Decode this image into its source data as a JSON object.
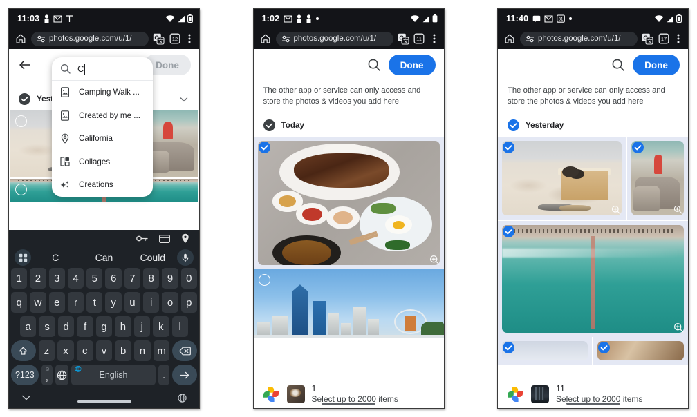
{
  "phones": [
    {
      "id": "phone-1",
      "status": {
        "time": "11:03",
        "left_icons": [
          "person-icon",
          "gmail-icon",
          "signal-t-icon"
        ],
        "right_icons": [
          "wifi-icon",
          "cellular-icon",
          "battery-icon"
        ]
      },
      "browser": {
        "url": "photos.google.com/u/1/",
        "home_icon": "home-icon",
        "lock_icon": "tune-icon",
        "translate_icon": "translate-icon",
        "tabs_icon": "tabs-icon",
        "menu_icon": "kebab-menu-icon",
        "tab_count": "12"
      },
      "app_header": {
        "back_icon": "back-arrow-icon",
        "done_label": "Done",
        "done_disabled": true
      },
      "section": {
        "label": "Yesterday",
        "checked": true
      },
      "search_overlay": {
        "query": "C",
        "search_icon": "search-icon",
        "suggestions": [
          {
            "icon": "photo-album-icon",
            "label": "Camping Walk ..."
          },
          {
            "icon": "photo-album-icon",
            "label": "Created by me ..."
          },
          {
            "icon": "location-pin-icon",
            "label": "California"
          },
          {
            "icon": "collage-icon",
            "label": "Collages"
          },
          {
            "icon": "sparkle-icon",
            "label": "Creations"
          }
        ]
      },
      "keyboard": {
        "toolbar_icons": [
          "key-icon",
          "card-icon",
          "location-pin-icon"
        ],
        "apps_icon": "keyboard-apps-icon",
        "mic_icon": "microphone-icon",
        "suggestions": [
          "C",
          "Can",
          "Could"
        ],
        "rows": [
          [
            "1",
            "2",
            "3",
            "4",
            "5",
            "6",
            "7",
            "8",
            "9",
            "0"
          ],
          [
            "q",
            "w",
            "e",
            "r",
            "t",
            "y",
            "u",
            "i",
            "o",
            "p"
          ],
          [
            "a",
            "s",
            "d",
            "f",
            "g",
            "h",
            "j",
            "k",
            "l"
          ],
          [
            "z",
            "x",
            "c",
            "v",
            "b",
            "n",
            "m"
          ]
        ],
        "shift_icon": "shift-icon",
        "backspace_icon": "backspace-icon",
        "symbols_label": "?123",
        "comma_label": ",",
        "comma_sup": "☺",
        "globe_icon": "globe-icon",
        "space_label": "English",
        "space_sup": "🌐",
        "period_label": ".",
        "enter_icon": "enter-arrow-icon",
        "nav_down_icon": "chevron-down-icon",
        "nav_globe_icon": "globe-icon"
      }
    },
    {
      "id": "phone-2",
      "status": {
        "time": "1:02",
        "left_icons": [
          "gmail-icon",
          "person-icon",
          "person-icon",
          "dot-icon"
        ],
        "right_icons": [
          "wifi-icon",
          "cellular-icon",
          "battery-icon"
        ]
      },
      "browser": {
        "url": "photos.google.com/u/1/",
        "home_icon": "home-icon",
        "lock_icon": "tune-icon",
        "translate_icon": "translate-icon",
        "tabs_icon": "tabs-icon",
        "menu_icon": "kebab-menu-icon",
        "tab_count": "11"
      },
      "app_header": {
        "search_icon": "search-icon",
        "done_label": "Done",
        "done_disabled": false
      },
      "notice": "The other app or service can only access and store the photos & videos you add here",
      "section": {
        "label": "Today",
        "checked": true,
        "checked_color": "#3c4043"
      },
      "bottom": {
        "count": "1",
        "hint": "Select up to 2000 items",
        "logo": "google-photos-logo",
        "thumb": "food-photo-thumb"
      }
    },
    {
      "id": "phone-3",
      "status": {
        "time": "11:40",
        "left_icons": [
          "message-icon",
          "gmail-icon",
          "calendar-icon",
          "dot-icon"
        ],
        "right_icons": [
          "wifi-icon",
          "cellular-icon",
          "battery-icon"
        ]
      },
      "browser": {
        "url": "photos.google.com/u/1/",
        "home_icon": "home-icon",
        "lock_icon": "tune-icon",
        "translate_icon": "translate-icon",
        "tabs_icon": "tabs-icon",
        "menu_icon": "kebab-menu-icon",
        "tab_count": "17"
      },
      "app_header": {
        "search_icon": "search-icon",
        "done_label": "Done",
        "done_disabled": false
      },
      "notice": "The other app or service can only access and store the photos & videos you add here",
      "section": {
        "label": "Yesterday",
        "checked": true,
        "checked_color": "#1a73e8"
      },
      "bottom": {
        "count": "11",
        "hint": "Select up to 2000 items",
        "logo": "google-photos-logo",
        "thumb": "night-photo-thumb"
      }
    }
  ]
}
